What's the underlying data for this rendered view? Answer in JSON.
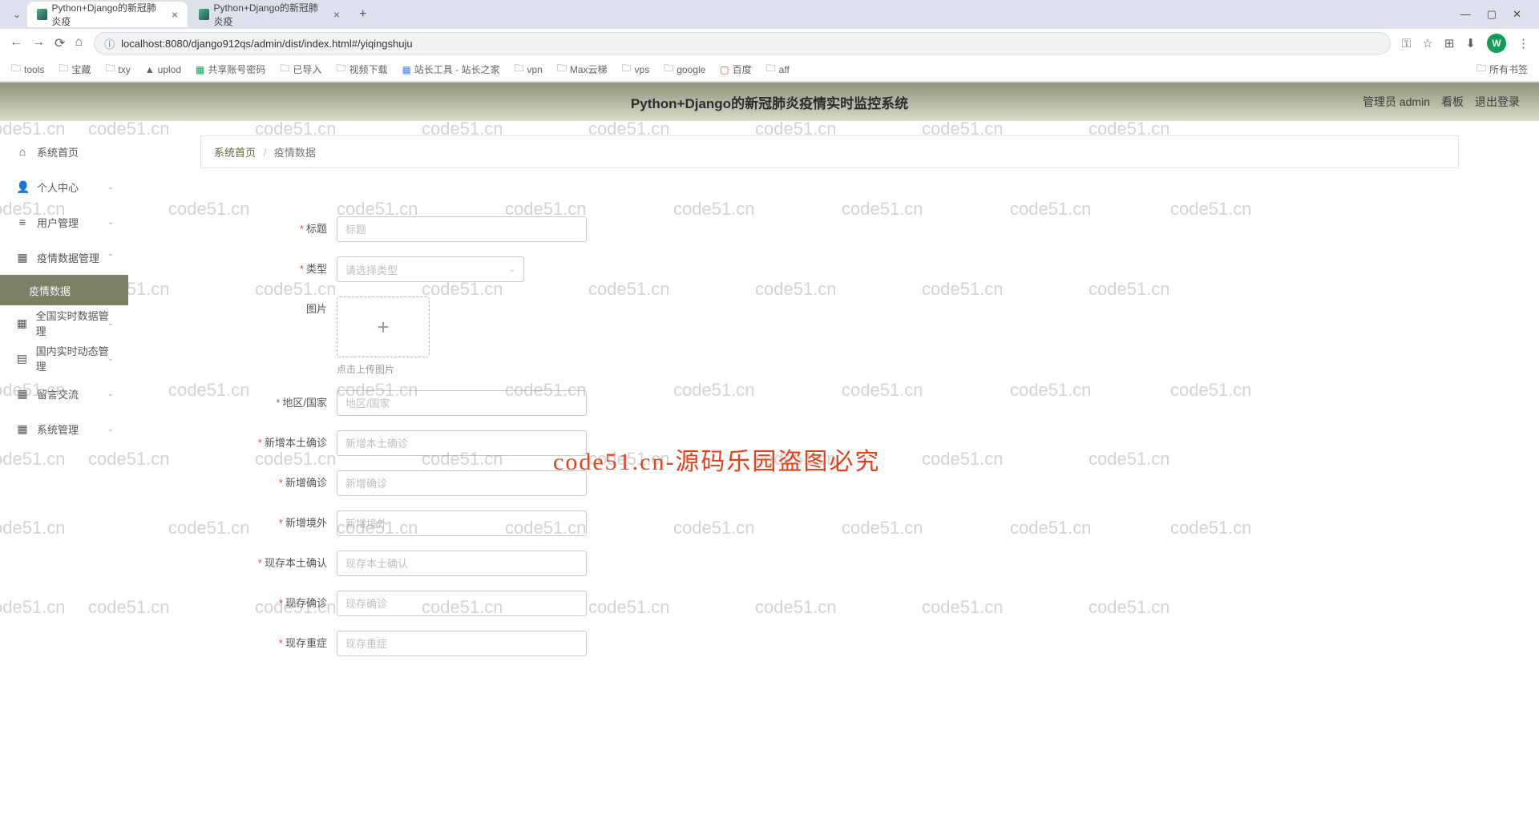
{
  "browser": {
    "tabs": [
      {
        "title": "Python+Django的新冠肺炎疫"
      },
      {
        "title": "Python+Django的新冠肺炎疫"
      }
    ],
    "url": "localhost:8080/django912qs/admin/dist/index.html#/yiqingshuju",
    "profile_letter": "W",
    "all_bookmarks": "所有书签"
  },
  "bookmarks": [
    "tools",
    "宝藏",
    "txy",
    "uplod",
    "共享账号密码",
    "已导入",
    "视频下载",
    "站长工具 - 站长之家",
    "vpn",
    "Max云梯",
    "vps",
    "google",
    "百度",
    "aff"
  ],
  "header": {
    "title": "Python+Django的新冠肺炎疫情实时监控系统",
    "user": "管理员 admin",
    "kanban": "看板",
    "logout": "退出登录"
  },
  "sidebar": {
    "items": [
      {
        "icon": "⌂",
        "label": "系统首页",
        "chev": false
      },
      {
        "icon": "👤",
        "label": "个人中心",
        "chev": true
      },
      {
        "icon": "≡",
        "label": "用户管理",
        "chev": true
      },
      {
        "icon": "▦",
        "label": "疫情数据管理",
        "chev": true,
        "expanded": true
      },
      {
        "icon": "▦",
        "label": "全国实时数据管理",
        "chev": true
      },
      {
        "icon": "▤",
        "label": "国内实时动态管理",
        "chev": true
      },
      {
        "icon": "▦",
        "label": "留言交流",
        "chev": true
      },
      {
        "icon": "▦",
        "label": "系统管理",
        "chev": true
      }
    ],
    "sub_active": "疫情数据"
  },
  "breadcrumb": {
    "home": "系统首页",
    "current": "疫情数据"
  },
  "form": {
    "title": {
      "label": "标题",
      "placeholder": "标题"
    },
    "type": {
      "label": "类型",
      "placeholder": "请选择类型"
    },
    "image": {
      "label": "图片",
      "hint": "点击上传图片"
    },
    "region": {
      "label": "地区/国家",
      "placeholder": "地区/国家"
    },
    "new_local": {
      "label": "新增本土确诊",
      "placeholder": "新增本土确诊"
    },
    "new_confirm": {
      "label": "新增确诊",
      "placeholder": "新增确诊"
    },
    "new_overseas": {
      "label": "新增境外",
      "placeholder": "新增境外"
    },
    "exist_local": {
      "label": "现存本土确认",
      "placeholder": "现存本土确认"
    },
    "exist_confirm": {
      "label": "现存确诊",
      "placeholder": "现存确诊"
    },
    "exist_severe": {
      "label": "现存重症",
      "placeholder": "现存重症"
    }
  },
  "watermark": {
    "text": "code51.cn",
    "center": "code51.cn-源码乐园盗图必究"
  }
}
